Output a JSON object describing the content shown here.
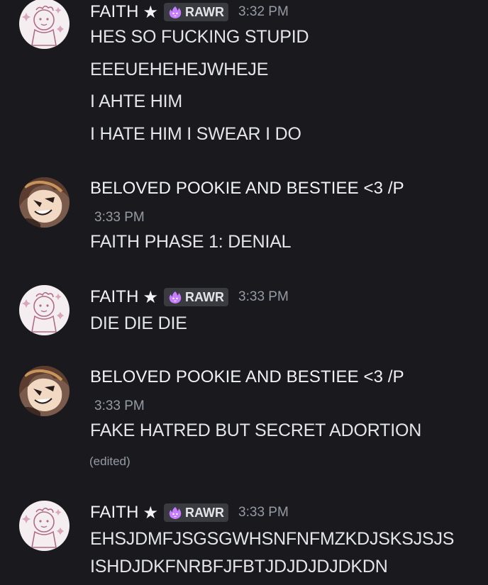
{
  "messages": [
    {
      "author": "FAITH",
      "star": "★",
      "tag": "RAWR",
      "timestamp": "3:32 PM",
      "lines": [
        "HES SO FUCKING STUPID",
        "EEEUEHEHEJWHEJE",
        "I AHTE HIM",
        "I HATE HIM I SWEAR I DO"
      ]
    },
    {
      "author": "BELOVED POOKIE AND BESTIEE <3 /P",
      "timestamp": "3:33 PM",
      "lines": [
        "FAITH PHASE 1: DENIAL"
      ]
    },
    {
      "author": "FAITH",
      "star": "★",
      "tag": "RAWR",
      "timestamp": "3:33 PM",
      "lines": [
        "DIE DIE DIE"
      ]
    },
    {
      "author": "BELOVED POOKIE AND BESTIEE <3 /P",
      "timestamp": "3:33 PM",
      "lines": [
        "FAKE HATRED BUT SECRET ADORTION"
      ],
      "edited": "(edited)"
    },
    {
      "author": "FAITH",
      "star": "★",
      "tag": "RAWR",
      "timestamp": "3:33 PM",
      "lines": [
        "EHSJDMFJSGSGWHSNFNFMZKDJSKSJSJS",
        "ISHDJDKFNRBFJFBTJDJDJDJDKDN"
      ]
    }
  ],
  "icons": {
    "avatar_faith": "faith-avatar",
    "avatar_pookie": "pookie-avatar",
    "tag_icon": "purple-flame-cat-icon"
  },
  "colors": {
    "background": "#1a1a1e",
    "tag_background": "#3a3a41",
    "timestamp": "#949ba4",
    "tag_icon": "#c77dff"
  }
}
